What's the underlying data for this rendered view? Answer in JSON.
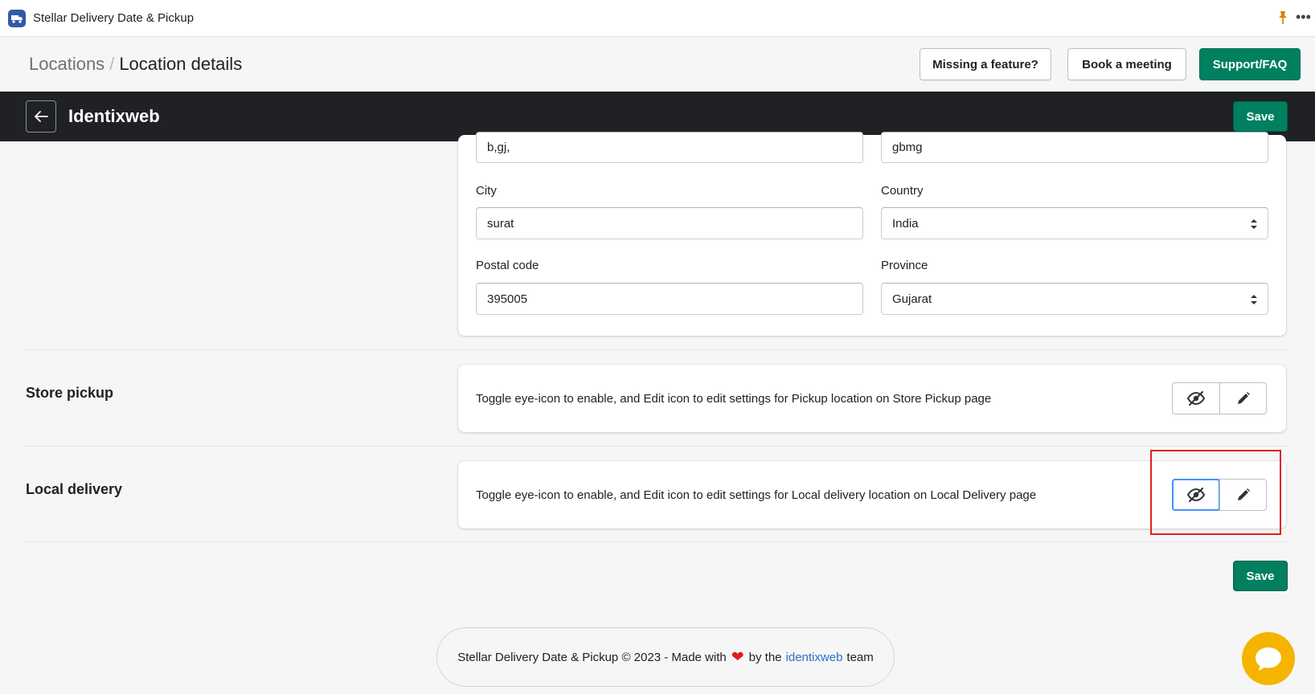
{
  "app": {
    "title": "Stellar Delivery Date & Pickup",
    "icons": [
      "truck-icon",
      "pin-icon",
      "more-icon"
    ]
  },
  "breadcrumb": {
    "parent": "Locations",
    "separator": "/",
    "current": "Location details"
  },
  "header_buttons": {
    "missing_feature": "Missing a feature?",
    "book_meeting": "Book a meeting",
    "support": "Support/FAQ"
  },
  "contextbar": {
    "title": "Identixweb",
    "save_label": "Save"
  },
  "address": {
    "address_line_1": "b,gj,",
    "address_line_2": "gbmg",
    "city_label": "City",
    "city_value": "surat",
    "country_label": "Country",
    "country_value": "India",
    "postal_label": "Postal code",
    "postal_value": "395005",
    "province_label": "Province",
    "province_value": "Gujarat"
  },
  "store_pickup": {
    "title": "Store pickup",
    "description": "Toggle eye-icon to enable, and Edit icon to edit settings for Pickup location on Store Pickup page"
  },
  "local_delivery": {
    "title": "Local delivery",
    "description": "Toggle eye-icon to enable, and Edit icon to edit settings for Local delivery location on Local Delivery page"
  },
  "bottom_save_label": "Save",
  "footer": {
    "prefix": "Stellar Delivery Date & Pickup © 2023 - Made with",
    "by_the": "by the",
    "link": "identixweb",
    "suffix": "team"
  },
  "colors": {
    "primary": "#008060",
    "contextbar": "#1f2124",
    "highlight": "#e02020",
    "link": "#2c6ecb",
    "chat": "#f4b400"
  }
}
